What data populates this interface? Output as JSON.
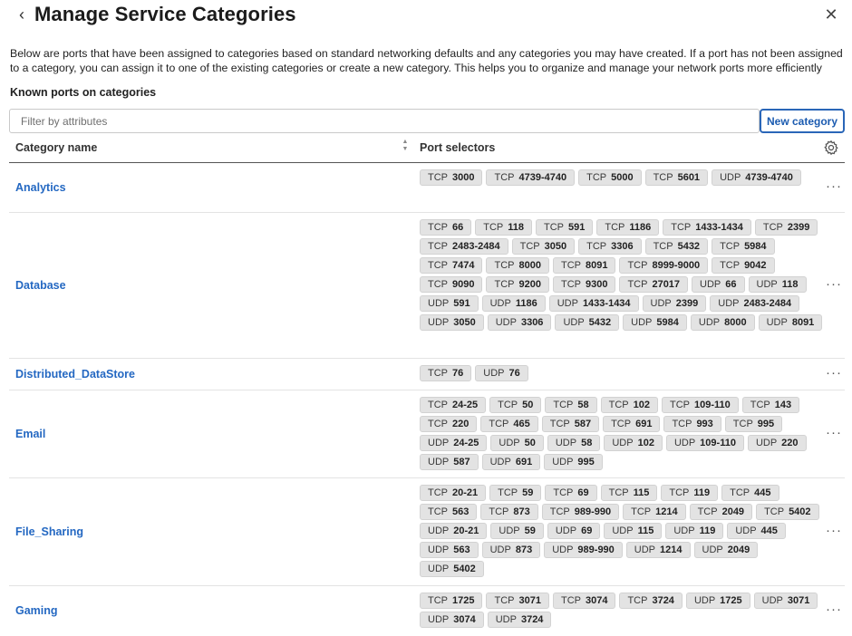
{
  "header": {
    "back_icon": "‹",
    "title": "Manage Service Categories",
    "close_icon": "✕"
  },
  "description": "Below are ports that have been assigned to categories based on standard networking defaults and any categories you may have created. If a port has not been assigned to a category, you can assign it to one of the existing categories or create a new category. This helps you to organize and manage your network ports more efficiently",
  "section_title": "Known ports on categories",
  "filter": {
    "placeholder": "Filter by attributes",
    "value": ""
  },
  "new_category_label": "New category",
  "table": {
    "col_category": "Category name",
    "col_ports": "Port selectors",
    "sort_icon": "sort-icon",
    "settings_icon": "gear-icon",
    "more_icon": "more-horizontal-icon",
    "rows": [
      {
        "name": "Analytics",
        "ports": [
          [
            "TCP",
            "3000"
          ],
          [
            "TCP",
            "4739-4740"
          ],
          [
            "TCP",
            "5000"
          ],
          [
            "TCP",
            "5601"
          ],
          [
            "UDP",
            "4739-4740"
          ]
        ]
      },
      {
        "name": "Database",
        "ports": [
          [
            "TCP",
            "66"
          ],
          [
            "TCP",
            "118"
          ],
          [
            "TCP",
            "591"
          ],
          [
            "TCP",
            "1186"
          ],
          [
            "TCP",
            "1433-1434"
          ],
          [
            "TCP",
            "2399"
          ],
          [
            "TCP",
            "2483-2484"
          ],
          [
            "TCP",
            "3050"
          ],
          [
            "TCP",
            "3306"
          ],
          [
            "TCP",
            "5432"
          ],
          [
            "TCP",
            "5984"
          ],
          [
            "TCP",
            "7474"
          ],
          [
            "TCP",
            "8000"
          ],
          [
            "TCP",
            "8091"
          ],
          [
            "TCP",
            "8999-9000"
          ],
          [
            "TCP",
            "9042"
          ],
          [
            "TCP",
            "9090"
          ],
          [
            "TCP",
            "9200"
          ],
          [
            "TCP",
            "9300"
          ],
          [
            "TCP",
            "27017"
          ],
          [
            "UDP",
            "66"
          ],
          [
            "UDP",
            "118"
          ],
          [
            "UDP",
            "591"
          ],
          [
            "UDP",
            "1186"
          ],
          [
            "UDP",
            "1433-1434"
          ],
          [
            "UDP",
            "2399"
          ],
          [
            "UDP",
            "2483-2484"
          ],
          [
            "UDP",
            "3050"
          ],
          [
            "UDP",
            "3306"
          ],
          [
            "UDP",
            "5432"
          ],
          [
            "UDP",
            "5984"
          ],
          [
            "UDP",
            "8000"
          ],
          [
            "UDP",
            "8091"
          ]
        ]
      },
      {
        "name": "Distributed_DataStore",
        "ports": [
          [
            "TCP",
            "76"
          ],
          [
            "UDP",
            "76"
          ]
        ]
      },
      {
        "name": "Email",
        "ports": [
          [
            "TCP",
            "24-25"
          ],
          [
            "TCP",
            "50"
          ],
          [
            "TCP",
            "58"
          ],
          [
            "TCP",
            "102"
          ],
          [
            "TCP",
            "109-110"
          ],
          [
            "TCP",
            "143"
          ],
          [
            "TCP",
            "220"
          ],
          [
            "TCP",
            "465"
          ],
          [
            "TCP",
            "587"
          ],
          [
            "TCP",
            "691"
          ],
          [
            "TCP",
            "993"
          ],
          [
            "TCP",
            "995"
          ],
          [
            "UDP",
            "24-25"
          ],
          [
            "UDP",
            "50"
          ],
          [
            "UDP",
            "58"
          ],
          [
            "UDP",
            "102"
          ],
          [
            "UDP",
            "109-110"
          ],
          [
            "UDP",
            "220"
          ],
          [
            "UDP",
            "587"
          ],
          [
            "UDP",
            "691"
          ],
          [
            "UDP",
            "995"
          ]
        ]
      },
      {
        "name": "File_Sharing",
        "ports": [
          [
            "TCP",
            "20-21"
          ],
          [
            "TCP",
            "59"
          ],
          [
            "TCP",
            "69"
          ],
          [
            "TCP",
            "115"
          ],
          [
            "TCP",
            "119"
          ],
          [
            "TCP",
            "445"
          ],
          [
            "TCP",
            "563"
          ],
          [
            "TCP",
            "873"
          ],
          [
            "TCP",
            "989-990"
          ],
          [
            "TCP",
            "1214"
          ],
          [
            "TCP",
            "2049"
          ],
          [
            "TCP",
            "5402"
          ],
          [
            "UDP",
            "20-21"
          ],
          [
            "UDP",
            "59"
          ],
          [
            "UDP",
            "69"
          ],
          [
            "UDP",
            "115"
          ],
          [
            "UDP",
            "119"
          ],
          [
            "UDP",
            "445"
          ],
          [
            "UDP",
            "563"
          ],
          [
            "UDP",
            "873"
          ],
          [
            "UDP",
            "989-990"
          ],
          [
            "UDP",
            "1214"
          ],
          [
            "UDP",
            "2049"
          ],
          [
            "UDP",
            "5402"
          ]
        ]
      },
      {
        "name": "Gaming",
        "ports": [
          [
            "TCP",
            "1725"
          ],
          [
            "TCP",
            "3071"
          ],
          [
            "TCP",
            "3074"
          ],
          [
            "TCP",
            "3724"
          ],
          [
            "UDP",
            "1725"
          ],
          [
            "UDP",
            "3071"
          ],
          [
            "UDP",
            "3074"
          ],
          [
            "UDP",
            "3724"
          ]
        ]
      }
    ]
  },
  "colors": {
    "link": "#2468c2",
    "chip_bg": "#e3e3e3",
    "primary_border": "#2a66b8"
  }
}
